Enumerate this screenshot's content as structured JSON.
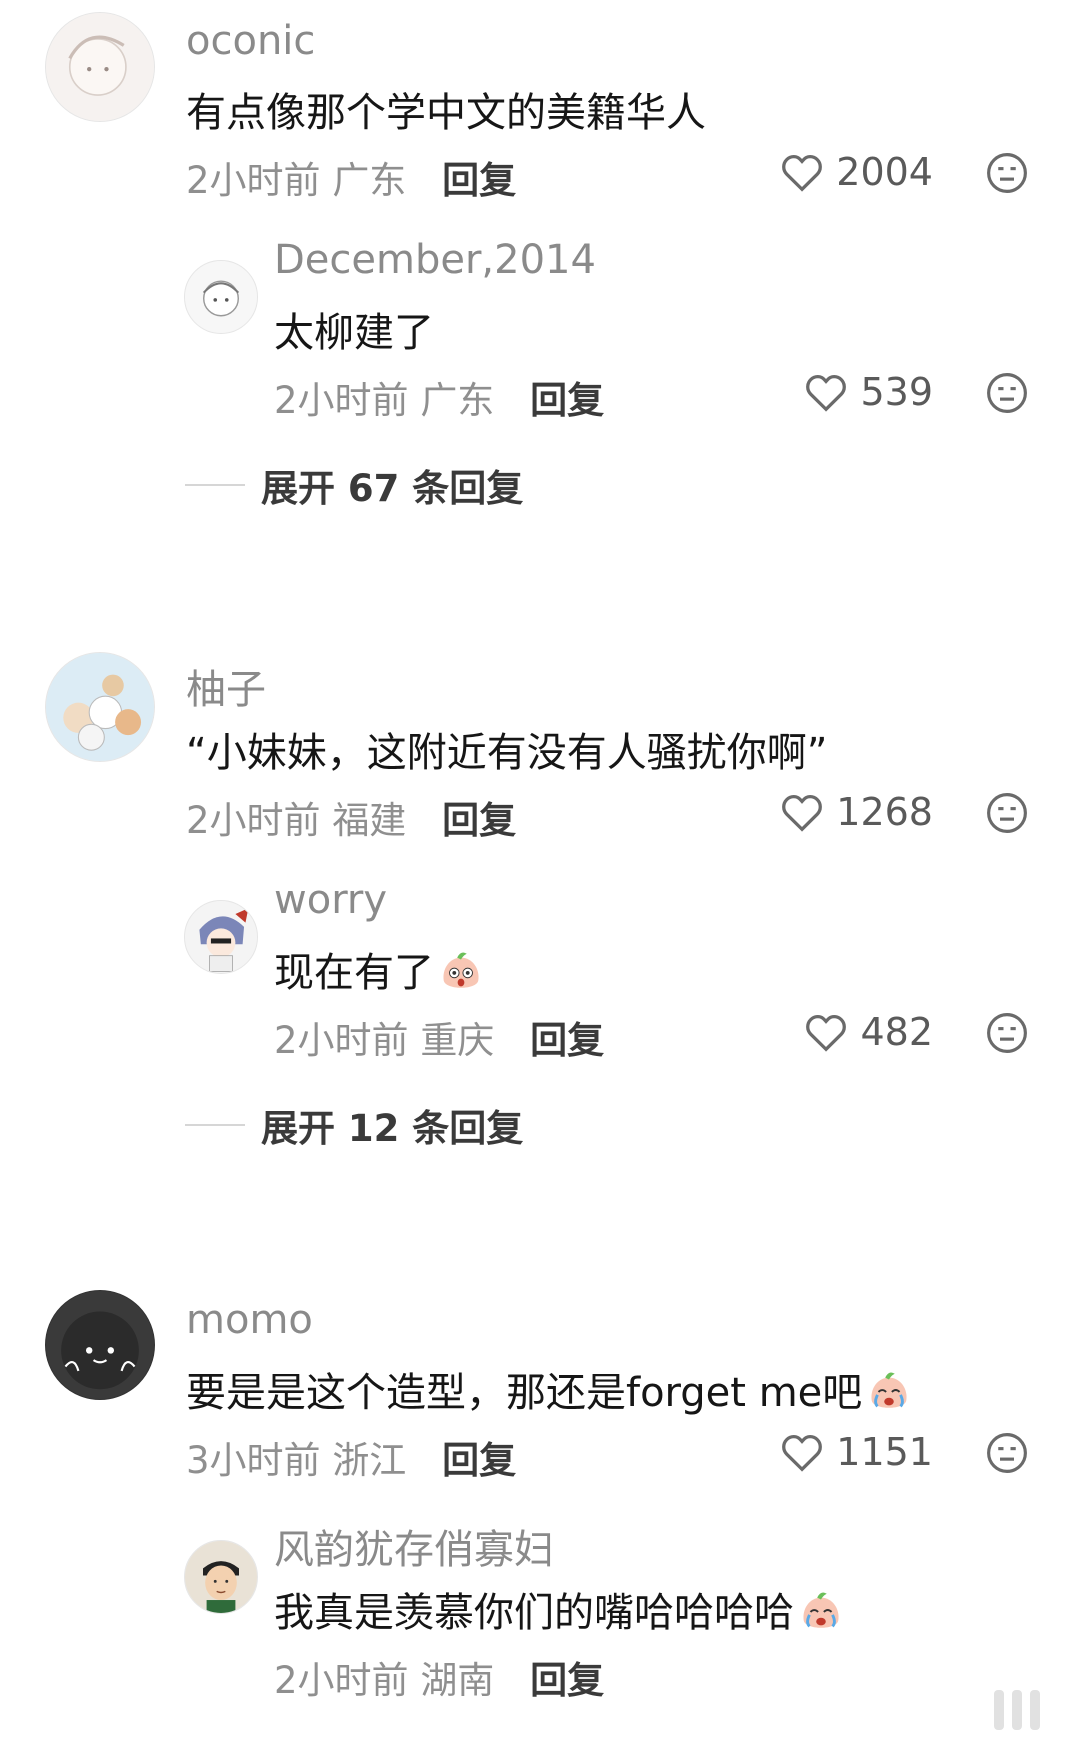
{
  "comments": [
    {
      "user": "oconic",
      "text": "有点像那个学中文的美籍华人",
      "time": "2小时前",
      "location": "广东",
      "reply_label": "回复",
      "likes": "2004",
      "replies": [
        {
          "user": "December,2014",
          "text": "太柳建了",
          "time": "2小时前",
          "location": "广东",
          "reply_label": "回复",
          "likes": "539"
        }
      ],
      "expand_label": "展开 67 条回复"
    },
    {
      "user": "柚子",
      "text": "“小妹妹，这附近有没有人骚扰你啊”",
      "time": "2小时前",
      "location": "福建",
      "reply_label": "回复",
      "likes": "1268",
      "replies": [
        {
          "user": "worry",
          "text": "现在有了",
          "emoji": "surprised-peach-emoji",
          "time": "2小时前",
          "location": "重庆",
          "reply_label": "回复",
          "likes": "482"
        }
      ],
      "expand_label": "展开 12 条回复"
    },
    {
      "user": "momo",
      "text": "要是是这个造型，那还是forget me吧",
      "emoji": "crying-peach-emoji",
      "time": "3小时前",
      "location": "浙江",
      "reply_label": "回复",
      "likes": "1151",
      "replies": [
        {
          "user": "风韵犹存俏寡妇",
          "text": "我真是羡慕你们的嘴哈哈哈哈",
          "emoji": "crying-peach-emoji",
          "time": "2小时前",
          "location": "湖南",
          "reply_label": "回复"
        }
      ]
    }
  ],
  "colors": {
    "name": "#8a8a8a",
    "text": "#161616",
    "meta": "#8f8f8f",
    "reply_button": "#3a3a3a",
    "icon": "#6a6a6a"
  }
}
